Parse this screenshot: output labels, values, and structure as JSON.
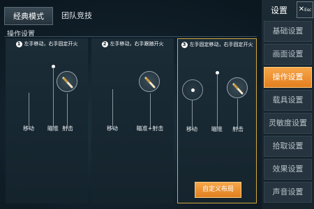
{
  "tabs": [
    {
      "label": "经典模式",
      "active": true
    },
    {
      "label": "团队竞技",
      "active": false
    }
  ],
  "section_title": "操作设置",
  "panels": [
    {
      "number": "1",
      "description": "左手移动，右手固定开火",
      "labels": {
        "move": "移动",
        "aim": "瞄准",
        "fire": "射击"
      }
    },
    {
      "number": "2",
      "description": "左手移动，右手跟随开火",
      "labels": {
        "move": "移动",
        "aim_fire": "瞄准+射击"
      }
    },
    {
      "number": "3",
      "description": "左手固定移动，右手固定开火",
      "labels": {
        "move": "移动",
        "aim": "瞄准",
        "fire": "射击"
      },
      "selected": true,
      "button_label": "自定义布局"
    }
  ],
  "sidebar": {
    "title": "设置",
    "close_label": "Esc",
    "items": [
      {
        "label": "基础设置",
        "active": false
      },
      {
        "label": "画面设置",
        "active": false
      },
      {
        "label": "操作设置",
        "active": true
      },
      {
        "label": "载具设置",
        "active": false
      },
      {
        "label": "灵敏度设置",
        "active": false
      },
      {
        "label": "拾取设置",
        "active": false
      },
      {
        "label": "效果设置",
        "active": false
      },
      {
        "label": "声音设置",
        "active": false
      }
    ]
  },
  "colors": {
    "accent_orange": "#e8902f",
    "selected_border": "#d7a93b",
    "background": "#14232c"
  }
}
